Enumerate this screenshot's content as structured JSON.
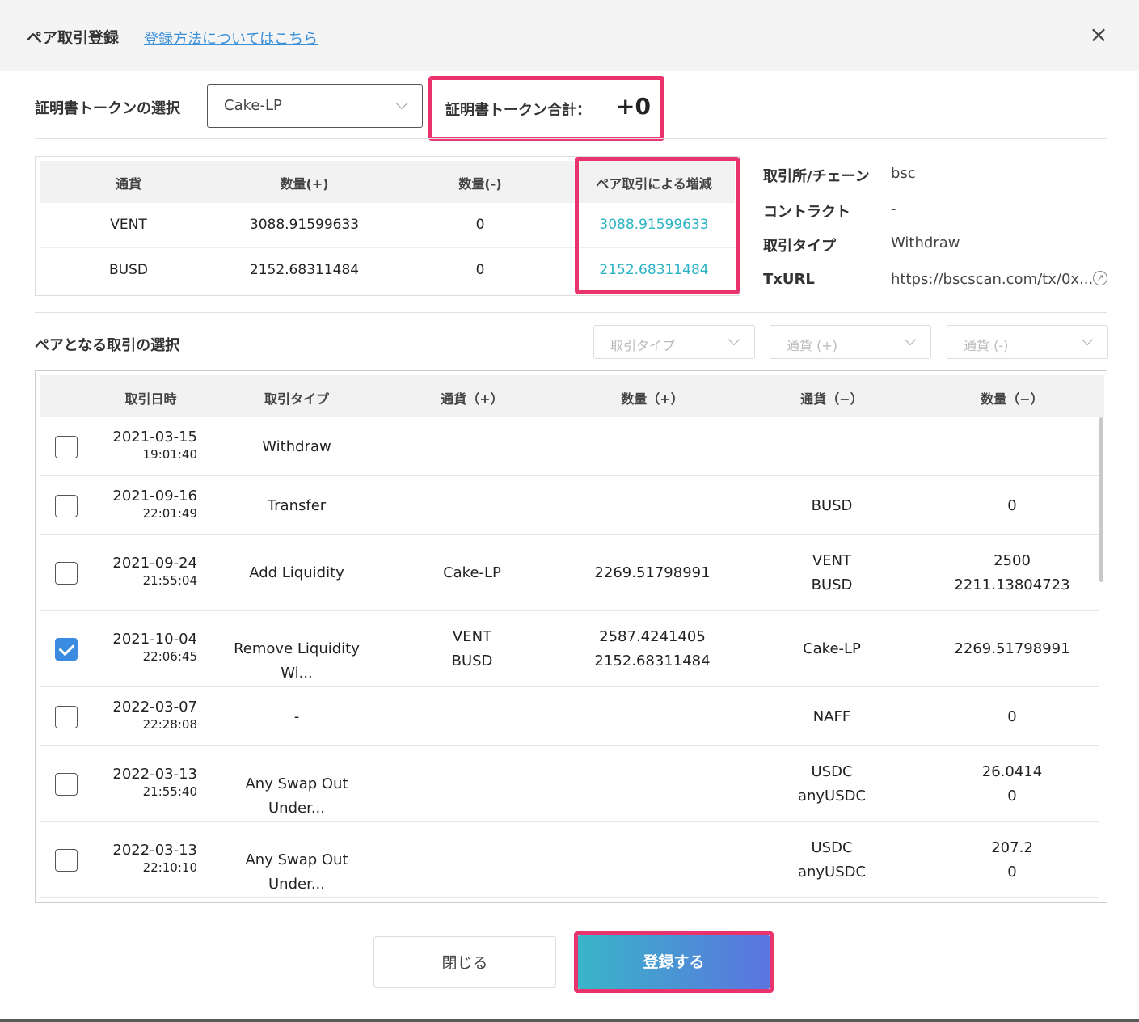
{
  "header": {
    "title": "ペア取引登録",
    "help_link": "登録方法についてはこちら",
    "close_icon": "×"
  },
  "token": {
    "label": "証明書トークンの選択",
    "selected": "Cake-LP",
    "total_label": "証明書トークン合計：",
    "total_value": "+0"
  },
  "summary": {
    "headers": [
      "通貨",
      "数量(+)",
      "数量(-)",
      "ペア取引による増減"
    ],
    "rows": [
      {
        "currency": "VENT",
        "plus": "3088.91599633",
        "minus": "0",
        "delta": "3088.91599633"
      },
      {
        "currency": "BUSD",
        "plus": "2152.68311484",
        "minus": "0",
        "delta": "2152.68311484"
      }
    ]
  },
  "info": {
    "exchange_label": "取引所/チェーン",
    "exchange_value": "bsc",
    "contract_label": "コントラクト",
    "contract_value": "-",
    "type_label": "取引タイプ",
    "type_value": "Withdraw",
    "txurl_label": "TxURL",
    "txurl_value": "https://bscscan.com/tx/0x...",
    "external_link_icon": "↗"
  },
  "pair_select": {
    "title": "ペアとなる取引の選択",
    "filters": [
      "取引タイプ",
      "通貨 (+)",
      "通貨 (-)"
    ]
  },
  "tx_table": {
    "headers": [
      "取引日時",
      "取引タイプ",
      "通貨（+）",
      "数量（+）",
      "通貨（−）",
      "数量（−）"
    ],
    "rows": [
      {
        "date": "2021-03-15",
        "time": "19:01:40",
        "type": "Withdraw",
        "cur_plus": [
          "",
          ""
        ],
        "qty_plus": [
          "",
          ""
        ],
        "cur_minus": [
          "",
          ""
        ],
        "qty_minus": [
          "",
          ""
        ],
        "checked": false
      },
      {
        "date": "2021-09-16",
        "time": "22:01:49",
        "type": "Transfer",
        "cur_plus": [
          "",
          ""
        ],
        "qty_plus": [
          "",
          ""
        ],
        "cur_minus": [
          "BUSD",
          ""
        ],
        "qty_minus": [
          "0",
          ""
        ],
        "checked": false
      },
      {
        "date": "2021-09-24",
        "time": "21:55:04",
        "type": "Add Liquidity",
        "cur_plus": [
          "Cake-LP",
          ""
        ],
        "qty_plus": [
          "2269.51798991",
          ""
        ],
        "cur_minus": [
          "VENT",
          "BUSD"
        ],
        "qty_minus": [
          "2500",
          "2211.13804723"
        ],
        "checked": false
      },
      {
        "date": "2021-10-04",
        "time": "22:06:45",
        "type": "Remove Liquidity Wi...",
        "cur_plus": [
          "VENT",
          "BUSD"
        ],
        "qty_plus": [
          "2587.4241405",
          "2152.68311484"
        ],
        "cur_minus": [
          "Cake-LP",
          ""
        ],
        "qty_minus": [
          "2269.51798991",
          ""
        ],
        "checked": true
      },
      {
        "date": "2022-03-07",
        "time": "22:28:08",
        "type": "-",
        "cur_plus": [
          "",
          ""
        ],
        "qty_plus": [
          "",
          ""
        ],
        "cur_minus": [
          "NAFF",
          ""
        ],
        "qty_minus": [
          "0",
          ""
        ],
        "checked": false
      },
      {
        "date": "2022-03-13",
        "time": "21:55:40",
        "type": "Any Swap Out Under...",
        "cur_plus": [
          "",
          ""
        ],
        "qty_plus": [
          "",
          ""
        ],
        "cur_minus": [
          "USDC",
          "anyUSDC"
        ],
        "qty_minus": [
          "26.0414",
          "0"
        ],
        "checked": false
      },
      {
        "date": "2022-03-13",
        "time": "22:10:10",
        "type": "Any Swap Out Under...",
        "cur_plus": [
          "",
          ""
        ],
        "qty_plus": [
          "",
          ""
        ],
        "cur_minus": [
          "USDC",
          "anyUSDC"
        ],
        "qty_minus": [
          "207.2",
          "0"
        ],
        "checked": false
      }
    ]
  },
  "buttons": {
    "close": "閉じる",
    "submit": "登録する"
  },
  "colors": {
    "highlight": "#e8336d",
    "teal": "#2bb3c4",
    "checkbox": "#3b8be0"
  }
}
